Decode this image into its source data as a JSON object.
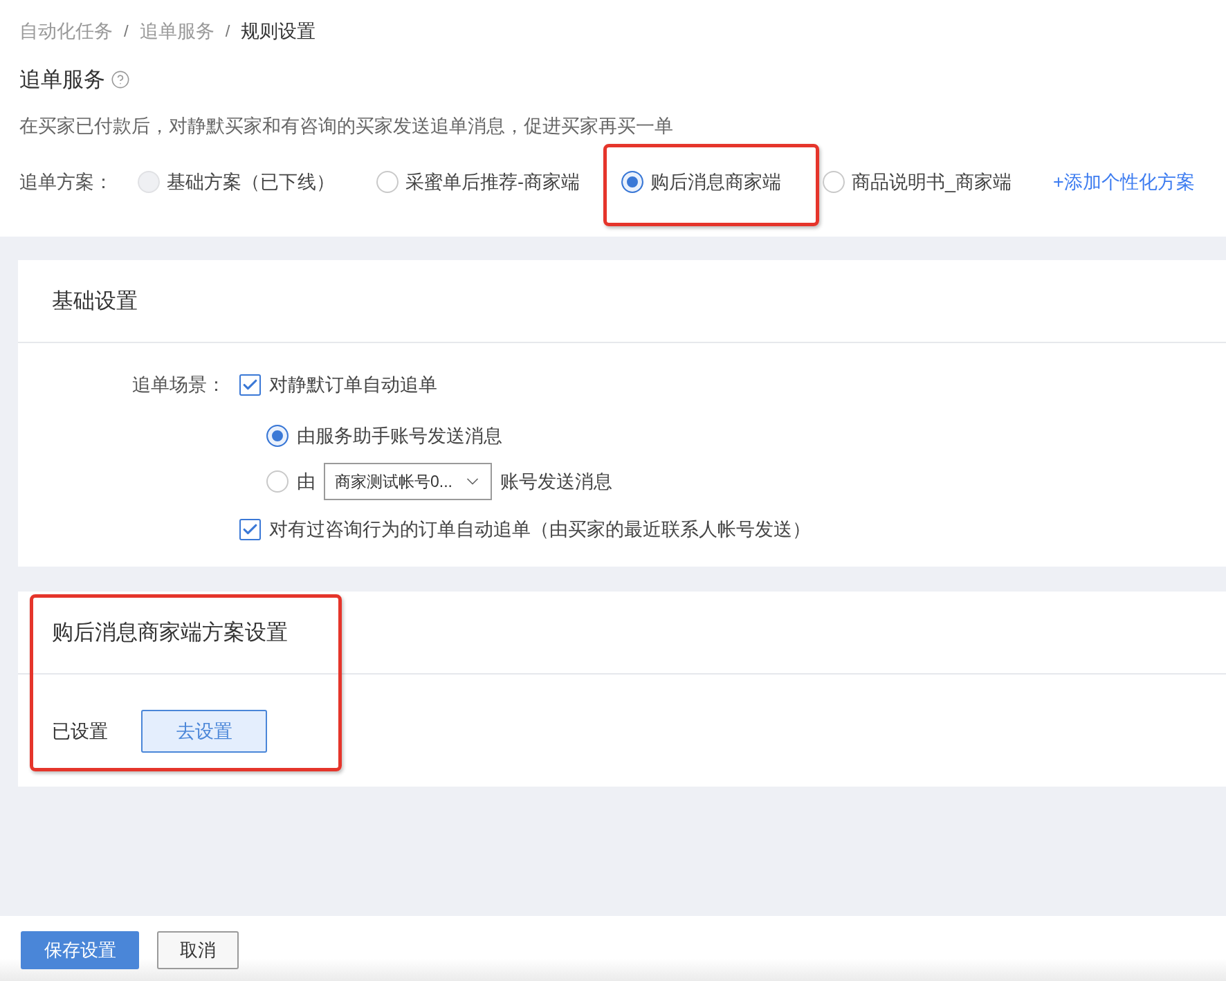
{
  "breadcrumb": [
    {
      "label": "自动化任务",
      "current": false,
      "separator": "/"
    },
    {
      "label": "追单服务",
      "current": false,
      "separator": "/"
    },
    {
      "label": "规则设置",
      "current": true
    }
  ],
  "page_title": "追单服务",
  "description": "在买家已付款后，对静默买家和有咨询的买家发送追单消息，促进买家再买一单",
  "plan": {
    "label": "追单方案：",
    "options": [
      {
        "label": "基础方案（已下线）",
        "selected": false,
        "disabled": true,
        "highlighted": false
      },
      {
        "label": "采蜜单后推荐-商家端",
        "selected": false,
        "disabled": false,
        "highlighted": false
      },
      {
        "label": "购后消息商家端",
        "selected": true,
        "disabled": false,
        "highlighted": true
      },
      {
        "label": "商品说明书_商家端",
        "selected": false,
        "disabled": false,
        "highlighted": false
      }
    ],
    "add_link": "+添加个性化方案"
  },
  "basic_settings": {
    "title": "基础设置",
    "scene_label": "追单场景：",
    "items": [
      {
        "kind": "checkbox",
        "label": "对静默订单自动追单",
        "checked": true,
        "children": [
          {
            "kind": "radio",
            "label": "由服务助手账号发送消息",
            "selected": true
          },
          {
            "kind": "radio_select",
            "prefix": "由",
            "select_value": "商家测试帐号0...",
            "suffix": "账号发送消息",
            "selected": false
          }
        ]
      },
      {
        "kind": "checkbox",
        "label": "对有过咨询行为的订单自动追单（由买家的最近联系人帐号发送）",
        "checked": true
      }
    ]
  },
  "plan_settings": {
    "title": "购后消息商家端方案设置",
    "highlighted": true,
    "status": "已设置",
    "button": "去设置"
  },
  "footer": {
    "buttons": [
      {
        "label": "保存设置",
        "kind": "primary"
      },
      {
        "label": "取消",
        "kind": "default"
      }
    ]
  }
}
